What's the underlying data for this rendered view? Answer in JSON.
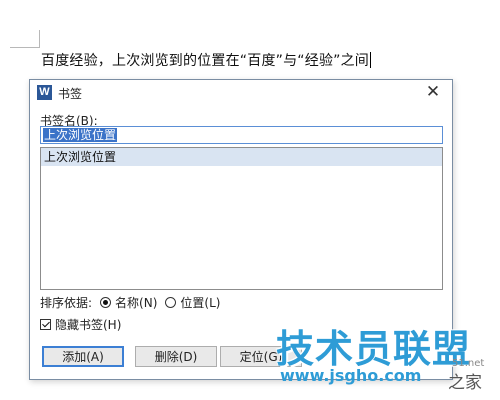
{
  "document": {
    "text": "百度经验，上次浏览到的位置在“百度”与“经验”之间"
  },
  "dialog": {
    "app_icon": "W",
    "title": "书签",
    "close_glyph": "✕",
    "name_label": "书签名(B):",
    "name_value": "上次浏览位置",
    "list_items": [
      "上次浏览位置"
    ],
    "sort_label": "排序依据:",
    "sort_options": [
      "名称(N)",
      "位置(L)"
    ],
    "sort_selected": "名称(N)",
    "hide_label": "隐藏书签(H)",
    "hide_checked": true,
    "buttons": {
      "add": "添加(A)",
      "delete": "删除(D)",
      "goto": "定位(G)"
    }
  },
  "watermark": {
    "brand": "技术员联盟",
    "url": "www.jsgho.com",
    "suffix": "之家",
    "fragment": "51.net"
  },
  "colors": {
    "accent": "#3b73c8",
    "list_selection": "#d9e4f2",
    "watermark": "#2e9cd6",
    "app_icon_bg": "#2b5797"
  }
}
